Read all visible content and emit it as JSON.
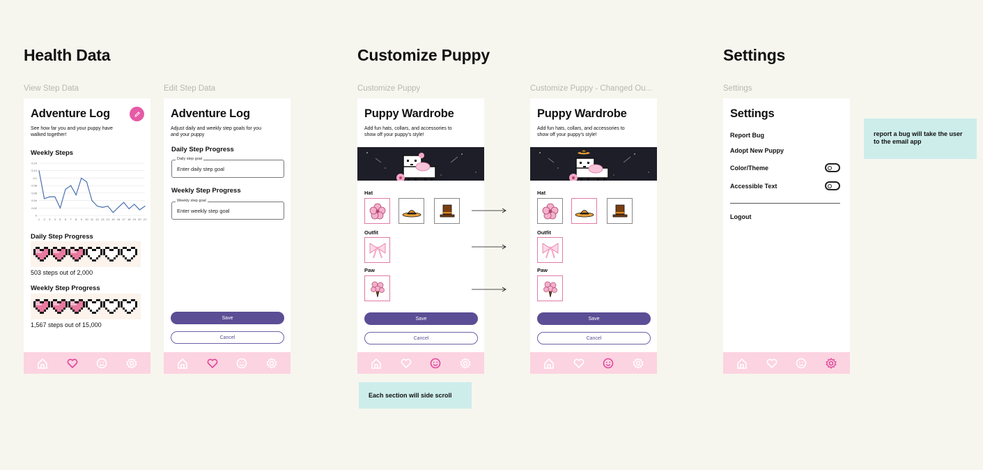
{
  "sections": {
    "health": "Health Data",
    "customize": "Customize Puppy",
    "settings": "Settings"
  },
  "frames": {
    "view_step": "View Step Data",
    "edit_step": "Edit Step Data",
    "customize": "Customize Puppy",
    "customize_changed": "Customize Puppy - Changed Ou...",
    "settings": "Settings"
  },
  "view": {
    "title": "Adventure Log",
    "subtitle": "See how far you and your puppy have walked together!",
    "weekly_steps": "Weekly Steps",
    "daily_progress": "Daily Step Progress",
    "daily_text": "503 steps out of 2,000",
    "weekly_progress": "Weekly Step Progress",
    "weekly_text": "1,567 steps out of 15,000",
    "daily_hearts_filled": 3,
    "weekly_hearts_filled": 3,
    "hearts_total": 6
  },
  "chart_data": {
    "type": "line",
    "x": [
      1,
      2,
      3,
      4,
      5,
      6,
      7,
      8,
      9,
      10,
      11,
      12,
      13,
      14,
      15,
      16,
      17,
      18,
      19,
      20,
      21
    ],
    "values": [
      0.12,
      0.045,
      0.05,
      0.05,
      0.02,
      0.07,
      0.08,
      0.055,
      0.1,
      0.09,
      0.04,
      0.025,
      0.022,
      0.025,
      0.008,
      0.022,
      0.035,
      0.018,
      0.03,
      0.015,
      0.025
    ],
    "ylim": [
      0,
      0.14
    ],
    "yticks": [
      "0",
      "0.02",
      "0.04",
      "0.06",
      "0.08",
      "0.1",
      "0.12",
      "0.14"
    ],
    "color": "#4a72b0",
    "grid": true
  },
  "edit": {
    "title": "Adventure Log",
    "subtitle": "Adjust daily and weekly step goals for you and your puppy",
    "daily_heading": "Daily Step Progress",
    "daily_label": "Daily step goal",
    "daily_placeholder": "Enter daily step goal",
    "weekly_heading": "Weekly Step Progress",
    "weekly_label": "Weekly step goal",
    "weekly_placeholder": "Enter weekly step goal",
    "save": "Save",
    "cancel": "Cancel"
  },
  "wardrobe": {
    "title": "Puppy Wardrobe",
    "subtitle": "Add fun hats, collars, and accessories to show off your puppy's style!",
    "hat": "Hat",
    "outfit": "Outfit",
    "paw": "Paw",
    "save": "Save",
    "cancel": "Cancel"
  },
  "settings_screen": {
    "title": "Settings",
    "report": "Report Bug",
    "adopt": "Adopt New Puppy",
    "theme": "Color/Theme",
    "accessible": "Accessible Text",
    "logout": "Logout"
  },
  "notes": {
    "side_scroll": "Each section will side scroll",
    "report_bug": "report a bug will take the user to the email app"
  },
  "colors": {
    "nav_bg": "#fcd3e1",
    "nav_active": "#e0479a",
    "nav_inactive": "#ffffff",
    "primary": "#5b4e95",
    "accent": "#e65aa6",
    "note_bg": "#cdedeb"
  }
}
